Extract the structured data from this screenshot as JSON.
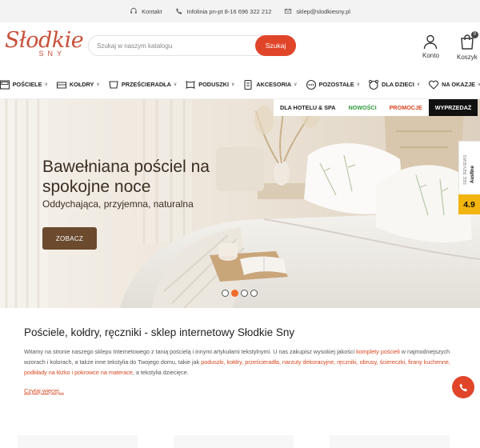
{
  "topbar": {
    "contact": "Kontakt",
    "phone": "Infolinia pn-pt 8-16 696 322 212",
    "email": "sklep@slodkiesny.pl"
  },
  "logo": {
    "line1": "Słodkie",
    "line2": "SNY"
  },
  "search": {
    "placeholder": "Szukaj w naszym katalogu",
    "button": "Szukaj"
  },
  "account": {
    "label": "Konto"
  },
  "cart": {
    "label": "Koszyk",
    "count": "0"
  },
  "nav": {
    "items": [
      {
        "label": "POŚCIELE",
        "icon": "bedding-icon"
      },
      {
        "label": "KOŁDRY",
        "icon": "duvet-icon"
      },
      {
        "label": "PRZEŚCIERADŁA",
        "icon": "sheet-icon"
      },
      {
        "label": "PODUSZKI",
        "icon": "pillow-icon"
      },
      {
        "label": "AKCESORIA",
        "icon": "accessories-icon"
      },
      {
        "label": "POZOSTAŁE",
        "icon": "more-icon"
      },
      {
        "label": "DLA DZIECI",
        "icon": "kids-icon"
      },
      {
        "label": "NA OKAZJE",
        "icon": "occasion-icon"
      }
    ]
  },
  "hero": {
    "title": "Bawełniana pościel na spokojne noce",
    "subtitle": "Oddychająca, przyjemna, naturalna",
    "button": "ZOBACZ",
    "tags": [
      {
        "label": "DLA HOTELU & SPA",
        "color": "#111111"
      },
      {
        "label": "NOWOŚCI",
        "color": "#2e9a3a"
      },
      {
        "label": "PROMOCJE",
        "color": "#d8451f"
      },
      {
        "label": "WYPRZEDAŻ",
        "color": "#ffffff"
      }
    ]
  },
  "reviews": {
    "text": "SEE REVIEWS",
    "brand": "Ausfine",
    "score": "4.9"
  },
  "intro": {
    "heading": "Pościele, kołdry, ręczniki - sklep internetowy Słodkie Sny",
    "p1": "Witamy na stronie naszego sklepu Internetowego z tanią pościelą i innymi artykułami tekstylnymi. U nas zakupisz wysokiej jakości ",
    "link1": "komplety pościeli",
    "p2": " w najmodniejszych wzorach i kolorach, a także inne tekstylia do Twojego domu, takie jak ",
    "link2": "poduszki, kołdry, prześcieradła, narzuty dekoracyjne, ręczniki, obrusy, ściereczki, firany kuchenne, podkłady na łóżko i pokrowce na materace",
    "p3": ", a tekstylia dziecięce.",
    "more": "Czytaj więcej..."
  },
  "colors": {
    "accent": "#e0452a",
    "brand": "#c8513a",
    "hero_button": "#6b4a2e"
  }
}
